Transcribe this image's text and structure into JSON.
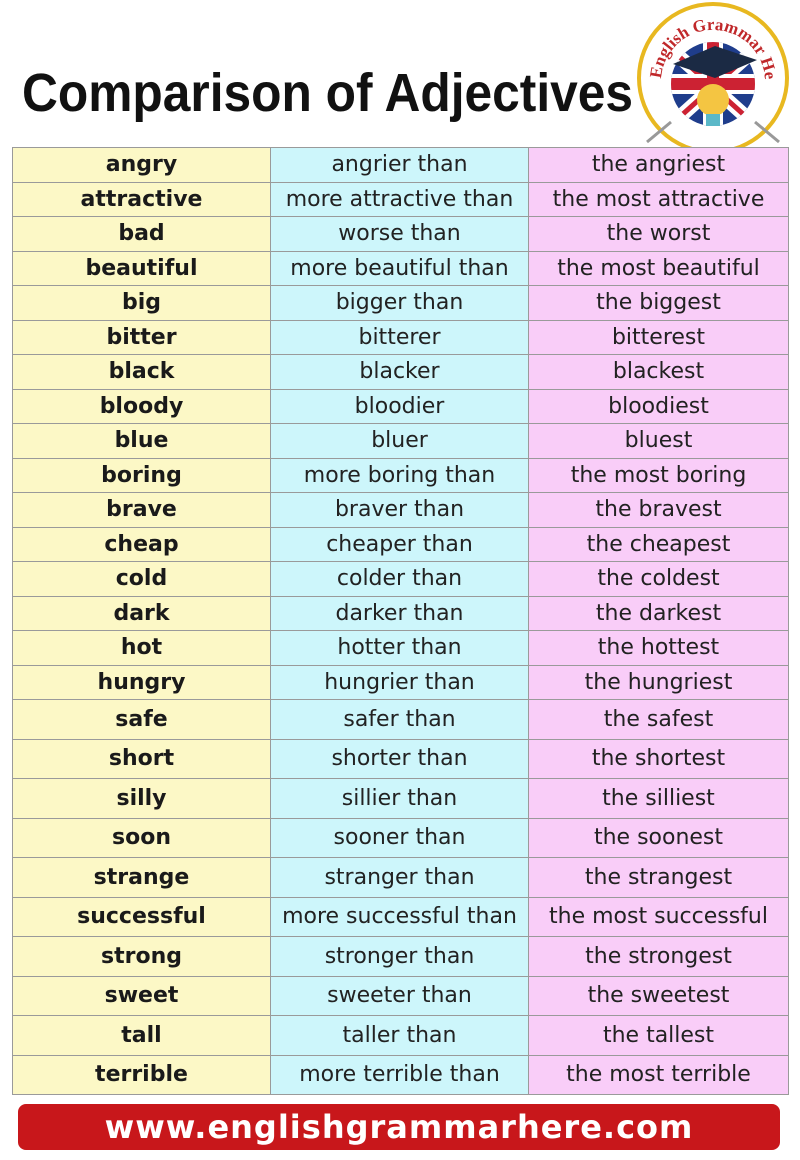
{
  "title": "Comparison of Adjectives",
  "logo": {
    "text": "English Grammar Here.Com"
  },
  "colors": {
    "base_column": "#fcf8c6",
    "comparative_column": "#cdf6fb",
    "superlative_column": "#f9cdf8",
    "footer": "#c8171b"
  },
  "rows": [
    [
      "angry",
      "angrier than",
      "the angriest"
    ],
    [
      "attractive",
      "more attractive than",
      "the most attractive"
    ],
    [
      "bad",
      "worse than",
      "the worst"
    ],
    [
      "beautiful",
      "more beautiful than",
      "the most beautiful"
    ],
    [
      "big",
      "bigger than",
      "the biggest"
    ],
    [
      "bitter",
      "bitterer",
      "bitterest"
    ],
    [
      "black",
      "blacker",
      "blackest"
    ],
    [
      "bloody",
      "bloodier",
      "bloodiest"
    ],
    [
      "blue",
      "bluer",
      "bluest"
    ],
    [
      "boring",
      "more boring than",
      "the most boring"
    ],
    [
      "brave",
      "braver than",
      "the bravest"
    ],
    [
      "cheap",
      "cheaper than",
      "the cheapest"
    ],
    [
      "cold",
      "colder than",
      "the coldest"
    ],
    [
      "dark",
      "darker than",
      "the darkest"
    ],
    [
      "hot",
      "hotter than",
      "the hottest"
    ],
    [
      "hungry",
      "hungrier than",
      "the hungriest"
    ],
    [
      "safe",
      "safer than",
      "the safest"
    ],
    [
      "short",
      "shorter than",
      "the shortest"
    ],
    [
      "silly",
      "sillier than",
      "the silliest"
    ],
    [
      "soon",
      "sooner than",
      "the soonest"
    ],
    [
      "strange",
      "stranger than",
      "the strangest"
    ],
    [
      "successful",
      "more successful than",
      "the most successful"
    ],
    [
      "strong",
      "stronger than",
      "the strongest"
    ],
    [
      "sweet",
      "sweeter than",
      "the sweetest"
    ],
    [
      "tall",
      "taller than",
      "the tallest"
    ],
    [
      "terrible",
      "more terrible than",
      "the most terrible"
    ]
  ],
  "footer": {
    "url": "www.englishgrammarhere.com"
  }
}
